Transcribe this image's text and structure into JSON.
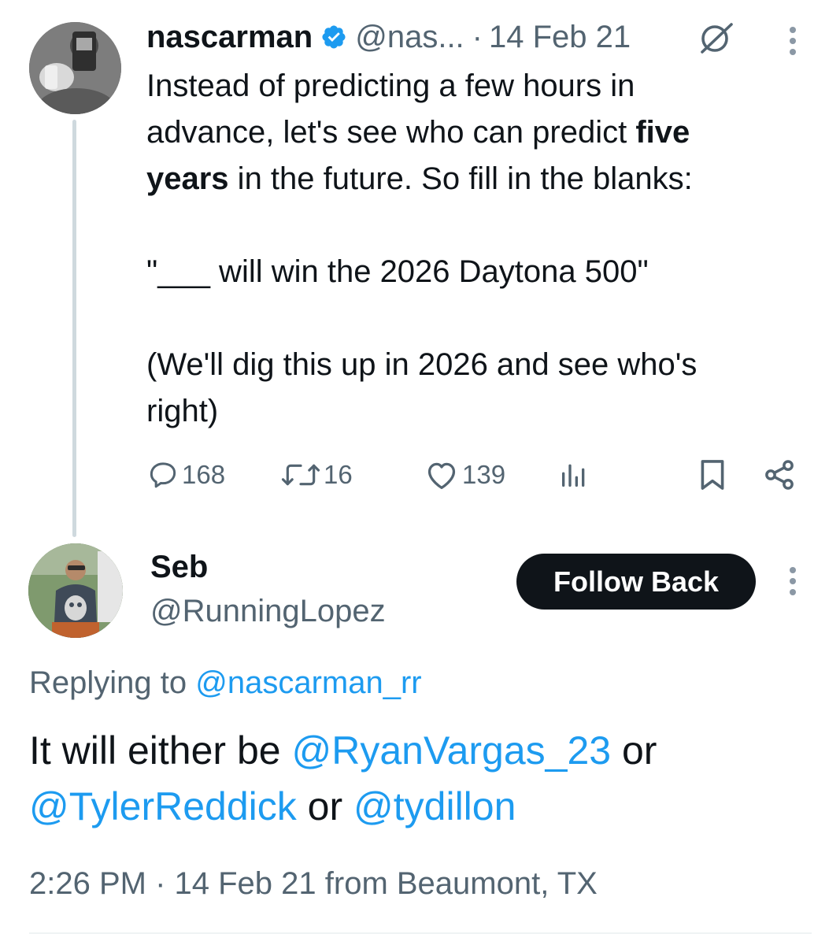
{
  "original_tweet": {
    "display_name": "nascarman",
    "handle": "@nas...",
    "separator": "·",
    "date": "14 Feb 21",
    "text_parts": [
      {
        "t": "Instead of predicting a few hours in\nadvance, let's see who can predict ",
        "bold": false
      },
      {
        "t": "five\nyears",
        "bold": true
      },
      {
        "t": " in the future. So fill in the blanks:\n\n\"___ will win the 2026 Daytona 500\"\n\n(We'll dig this up in 2026 and see who's\nright)",
        "bold": false
      }
    ],
    "actions": {
      "replies": "168",
      "reposts": "16",
      "likes": "139"
    },
    "icons": [
      "verified-badge-icon",
      "grok-icon",
      "more-options-icon",
      "reply-icon",
      "repost-icon",
      "like-icon",
      "views-icon",
      "bookmark-icon",
      "share-icon"
    ],
    "colors": {
      "verified": "#1d9bf0",
      "muted": "#536471"
    }
  },
  "reply_tweet": {
    "display_name": "Seb",
    "handle": "@RunningLopez",
    "follow_button_label": "Follow Back",
    "replying_to_label": "Replying to",
    "replying_to_handle": "@nascarman_rr",
    "text_parts": [
      {
        "t": "It will either be ",
        "mention": false
      },
      {
        "t": "@RyanVargas_23",
        "mention": true
      },
      {
        "t": " or\n",
        "mention": false
      },
      {
        "t": "@TylerReddick",
        "mention": true
      },
      {
        "t": " or ",
        "mention": false
      },
      {
        "t": "@tydillon",
        "mention": true
      }
    ],
    "timestamp": "2:26 PM · 14 Feb 21 from Beaumont, TX",
    "colors": {
      "mention": "#1d9bf0",
      "button_bg": "#0f1419",
      "button_text": "#ffffff"
    }
  }
}
